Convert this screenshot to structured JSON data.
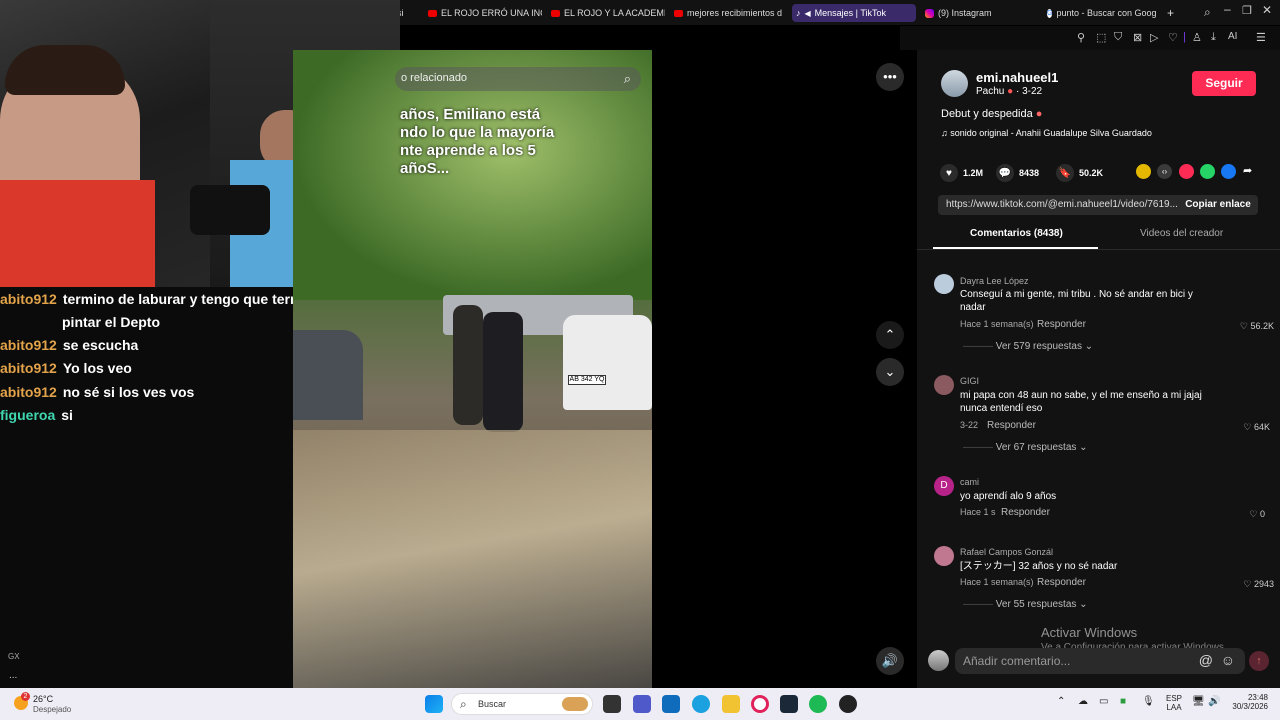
{
  "browser": {
    "tabs": [
      {
        "label": "ási",
        "icon": "youtube-icon"
      },
      {
        "label": "EL ROJO ERRÓ UNA INC",
        "icon": "youtube-icon"
      },
      {
        "label": "EL ROJO Y LA ACADEMI",
        "icon": "youtube-icon"
      },
      {
        "label": "mejores recibimientos d",
        "icon": "youtube-icon"
      },
      {
        "label": "Mensajes | TikTok",
        "icon": "tiktok-icon",
        "active": true
      },
      {
        "label": "(9) Instagram",
        "icon": "instagram-icon"
      },
      {
        "label": "punto - Buscar con Goog",
        "icon": "google-icon"
      }
    ],
    "new_tab": "+",
    "toolbar_ai": "AI"
  },
  "chat": [
    {
      "user": "abito912",
      "text": "termino de laburar y tengo que terminar de",
      "cont": "pintar el Depto"
    },
    {
      "user": "abito912",
      "text": "se escucha"
    },
    {
      "user": "abito912",
      "text": "Yo los veo"
    },
    {
      "user": "abito912",
      "text": "no sé si los ves vos"
    },
    {
      "user": "figueroa",
      "text": "si"
    }
  ],
  "obs": {
    "tag": "GX",
    "dots": "..."
  },
  "video": {
    "search_placeholder": "o relacionado",
    "overlay_text": "años, Emiliano está ndo lo que la mayoría nte aprende a los 5 añoS...",
    "plate": "AB 342 YQ"
  },
  "post": {
    "username": "emi.nahueel1",
    "nickname": "Pachu",
    "date": "· 3-22",
    "follow_label": "Seguir",
    "caption": "Debut y despedida",
    "sound": "sonido original - Anahii Guadalupe Silva Guardado",
    "likes": "1.2M",
    "comments": "8438",
    "saves": "50.2K",
    "link": "https://www.tiktok.com/@emi.nahueel1/video/7619...",
    "copy_label": "Copiar enlace",
    "tab_comments": "Comentarios (8438)",
    "tab_creator": "Videos del creador"
  },
  "comments": [
    {
      "name": "Dayra Lee López",
      "text1": "Conseguí a mi gente, mi tribu . No sé andar en bici y",
      "text2": "nadar",
      "time": "Hace 1 semana(s)",
      "reply": "Responder",
      "likes": "56.2K",
      "more": "Ver 579 respuestas"
    },
    {
      "name": "GIGI",
      "text1": "mi papa con 48 aun no sabe, y el me enseño a mi jajaj",
      "text2": "nunca entendí eso",
      "time": "3-22",
      "reply": "Responder",
      "likes": "64K",
      "more": "Ver 67 respuestas"
    },
    {
      "name": "cami",
      "text1": "yo aprendí alo 9 años",
      "text2": "",
      "time": "Hace 1 s",
      "reply": "Responder",
      "likes": "0",
      "more": "",
      "initial": "D"
    },
    {
      "name": "Rafael Campos Gonzál",
      "text1": "[ステッカー] 32 años y no sé nadar",
      "text2": "",
      "time": "Hace 1 semana(s)",
      "reply": "Responder",
      "likes": "2943",
      "more": "Ver 55 respuestas"
    }
  ],
  "comment_input": {
    "placeholder": "Añadir comentario..."
  },
  "windows_watermark": {
    "title": "Activar Windows",
    "sub": "Ve a Configuración para activar Windows."
  },
  "taskbar": {
    "weather_temp": "26°C",
    "weather_desc": "Despejado",
    "weather_badge": "2",
    "search_label": "Buscar",
    "lang1": "ESP",
    "lang2": "LAA",
    "time": "23:48",
    "date": "30/3/2026"
  }
}
